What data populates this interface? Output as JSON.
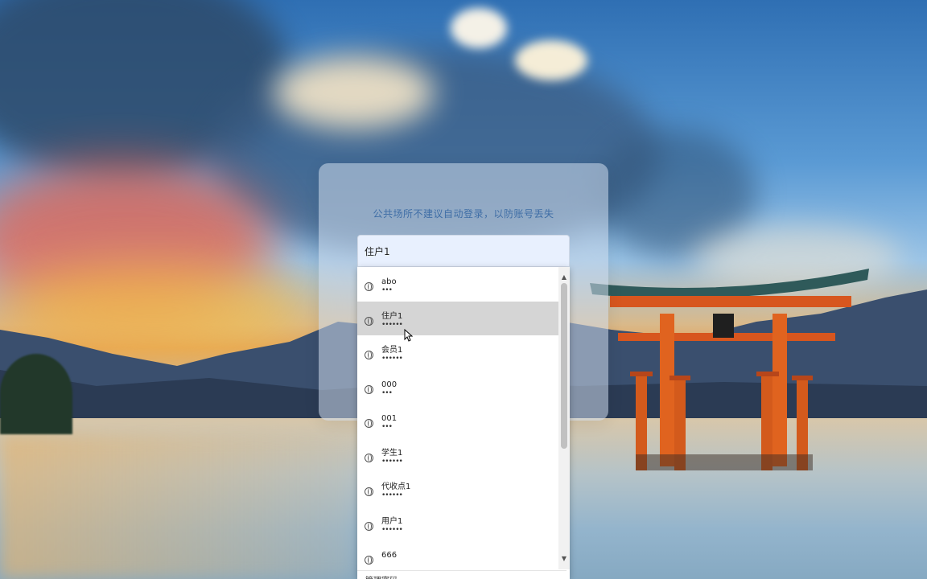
{
  "login": {
    "notice": "公共场所不建议自动登录，以防账号丢失",
    "username_value": "住户1"
  },
  "autocomplete": {
    "items": [
      {
        "name": "abo",
        "password_mask": "•••"
      },
      {
        "name": "住户1",
        "password_mask": "••••••"
      },
      {
        "name": "会员1",
        "password_mask": "••••••"
      },
      {
        "name": "000",
        "password_mask": "•••"
      },
      {
        "name": "001",
        "password_mask": "•••"
      },
      {
        "name": "学生1",
        "password_mask": "••••••"
      },
      {
        "name": "代收点1",
        "password_mask": "••••••"
      },
      {
        "name": "用户1",
        "password_mask": "••••••"
      },
      {
        "name": "666",
        "password_mask": ""
      }
    ],
    "hover_index": 1,
    "manage_label": "管理密码"
  },
  "icons": {
    "item_icon": "globe-icon",
    "scroll_up": "chevron-up-icon",
    "scroll_down": "chevron-down-icon",
    "cursor": "mouse-pointer-icon"
  }
}
